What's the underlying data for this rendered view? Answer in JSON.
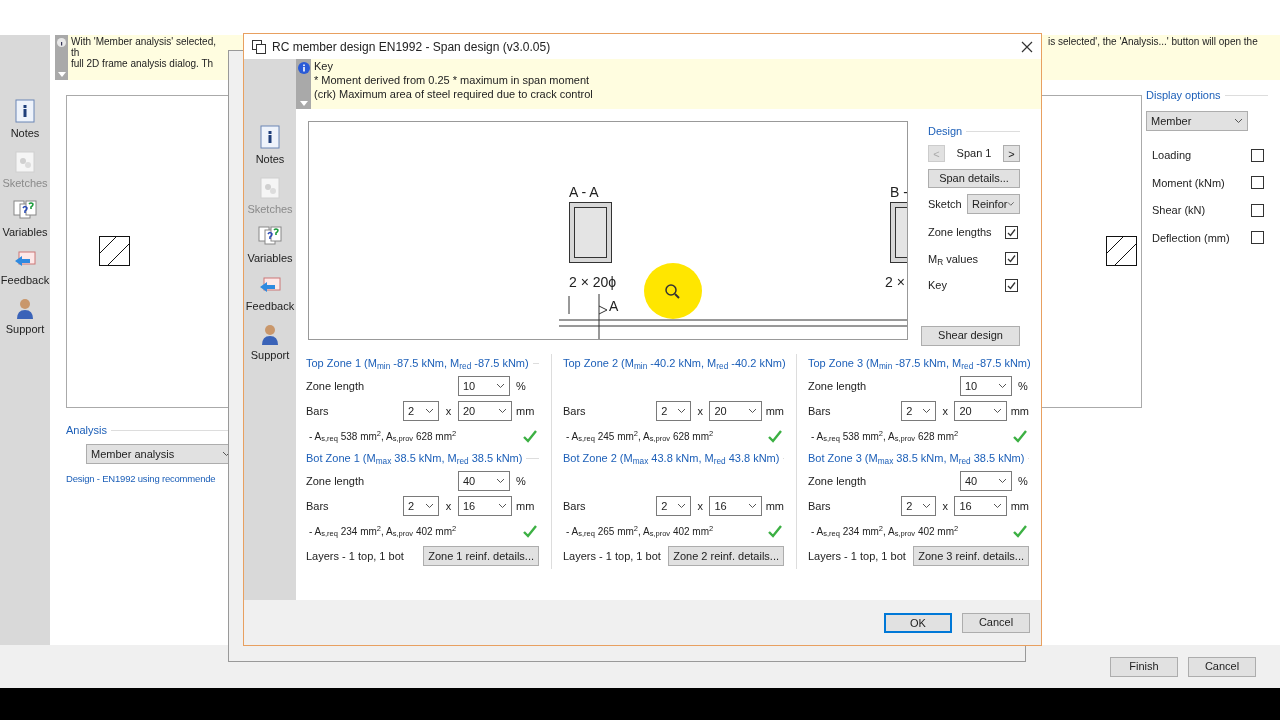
{
  "background_window": {
    "info_left": [
      "With 'Member analysis' selected, th",
      "full 2D frame analysis dialog. Th"
    ],
    "info_right": "is selected', the 'Analysis...' button will open the",
    "sidebar": [
      {
        "label": "Notes",
        "kind": "notes",
        "disabled": false
      },
      {
        "label": "Sketches",
        "kind": "sketches",
        "disabled": true
      },
      {
        "label": "Variables",
        "kind": "variables",
        "disabled": false
      },
      {
        "label": "Feedback",
        "kind": "feedback",
        "disabled": false
      },
      {
        "label": "Support",
        "kind": "support",
        "disabled": false
      }
    ],
    "analysis": {
      "heading": "Analysis",
      "value": "Member analysis",
      "design_link": "Design - EN1992 using recommende"
    },
    "display_options": {
      "heading": "Display options",
      "value": "Member",
      "options": [
        {
          "label": "Loading",
          "checked": false
        },
        {
          "label": "Moment (kNm)",
          "checked": false
        },
        {
          "label": "Shear (kN)",
          "checked": false
        },
        {
          "label": "Deflection (mm)",
          "checked": false
        }
      ]
    },
    "buttons": [
      "Finish",
      "Cancel"
    ]
  },
  "dialog": {
    "title": "RC member design EN1992 - Span design (v3.0.05)",
    "key": {
      "heading": "Key",
      "lines": [
        "* Moment derived from 0.25 * maximum in span moment",
        "(crk) Maximum area of steel required due to crack control"
      ]
    },
    "sidebar": [
      {
        "label": "Notes",
        "kind": "notes",
        "disabled": false
      },
      {
        "label": "Sketches",
        "kind": "sketches",
        "disabled": true
      },
      {
        "label": "Variables",
        "kind": "variables",
        "disabled": false
      },
      {
        "label": "Feedback",
        "kind": "feedback",
        "disabled": false
      },
      {
        "label": "Support",
        "kind": "support",
        "disabled": false
      }
    ],
    "sketch": {
      "section_a": "A - A",
      "bars_a": "2 × 20ϕ",
      "marker_a": "A",
      "section_b": "B -",
      "bars_b": "2 ×"
    },
    "design": {
      "heading": "Design",
      "prev": "<",
      "span": "Span 1",
      "next": ">",
      "span_details": "Span details...",
      "sketch_label": "Sketch",
      "sketch_value": "Reinfor",
      "options": [
        {
          "label": "Zone lengths",
          "checked": true
        },
        {
          "label": "M$_{R}$ values",
          "checked": true
        },
        {
          "label": "Key",
          "checked": true
        }
      ],
      "shear_design": "Shear design"
    },
    "zones": [
      {
        "top": {
          "heading": "Top Zone 1 (M$_{min}$ -87.5 kNm, M$_{red}$ -87.5 kNm)",
          "zone_length": {
            "label": "Zone length",
            "value": "10",
            "unit": "%"
          },
          "bars": {
            "label": "Bars",
            "count": "2",
            "x": "x",
            "size": "20",
            "unit": "mm"
          },
          "area": "- A$_{s,req}$ 538 mm$^{2}$, A$_{s,prov}$ 628 mm$^{2}$",
          "ok": true
        },
        "bot": {
          "heading": "Bot Zone 1 (M$_{max}$ 38.5 kNm, M$_{red}$ 38.5 kNm)",
          "zone_length": {
            "label": "Zone length",
            "value": "40",
            "unit": "%"
          },
          "bars": {
            "label": "Bars",
            "count": "2",
            "x": "x",
            "size": "16",
            "unit": "mm"
          },
          "area": "- A$_{s,req}$ 234 mm$^{2}$, A$_{s,prov}$ 402 mm$^{2}$",
          "ok": true
        },
        "layers": "Layers - 1 top, 1 bot",
        "details": "Zone 1 reinf. details..."
      },
      {
        "top": {
          "heading": "Top Zone 2 (M$_{min}$ -40.2 kNm, M$_{red}$ -40.2 kNm)",
          "bars": {
            "label": "Bars",
            "count": "2",
            "x": "x",
            "size": "20",
            "unit": "mm"
          },
          "area": "- A$_{s,req}$ 245 mm$^{2}$, A$_{s,prov}$ 628 mm$^{2}$",
          "ok": true
        },
        "bot": {
          "heading": "Bot Zone 2 (M$_{max}$ 43.8 kNm, M$_{red}$ 43.8 kNm)",
          "bars": {
            "label": "Bars",
            "count": "2",
            "x": "x",
            "size": "16",
            "unit": "mm"
          },
          "area": "- A$_{s,req}$ 265 mm$^{2}$, A$_{s,prov}$ 402 mm$^{2}$",
          "ok": true
        },
        "layers": "Layers - 1 top, 1 bot",
        "details": "Zone 2 reinf. details..."
      },
      {
        "top": {
          "heading": "Top Zone 3 (M$_{min}$ -87.5 kNm, M$_{red}$ -87.5 kNm)",
          "zone_length": {
            "label": "Zone length",
            "value": "10",
            "unit": "%"
          },
          "bars": {
            "label": "Bars",
            "count": "2",
            "x": "x",
            "size": "20",
            "unit": "mm"
          },
          "area": "- A$_{s,req}$ 538 mm$^{2}$, A$_{s,prov}$ 628 mm$^{2}$",
          "ok": true
        },
        "bot": {
          "heading": "Bot Zone 3 (M$_{max}$ 38.5 kNm, M$_{red}$ 38.5 kNm)",
          "zone_length": {
            "label": "Zone length",
            "value": "40",
            "unit": "%"
          },
          "bars": {
            "label": "Bars",
            "count": "2",
            "x": "x",
            "size": "16",
            "unit": "mm"
          },
          "area": "- A$_{s,req}$ 234 mm$^{2}$, A$_{s,prov}$ 402 mm$^{2}$",
          "ok": true
        },
        "layers": "Layers - 1 top, 1 bot",
        "details": "Zone 3 reinf. details..."
      }
    ],
    "buttons": [
      "OK",
      "Cancel"
    ]
  }
}
